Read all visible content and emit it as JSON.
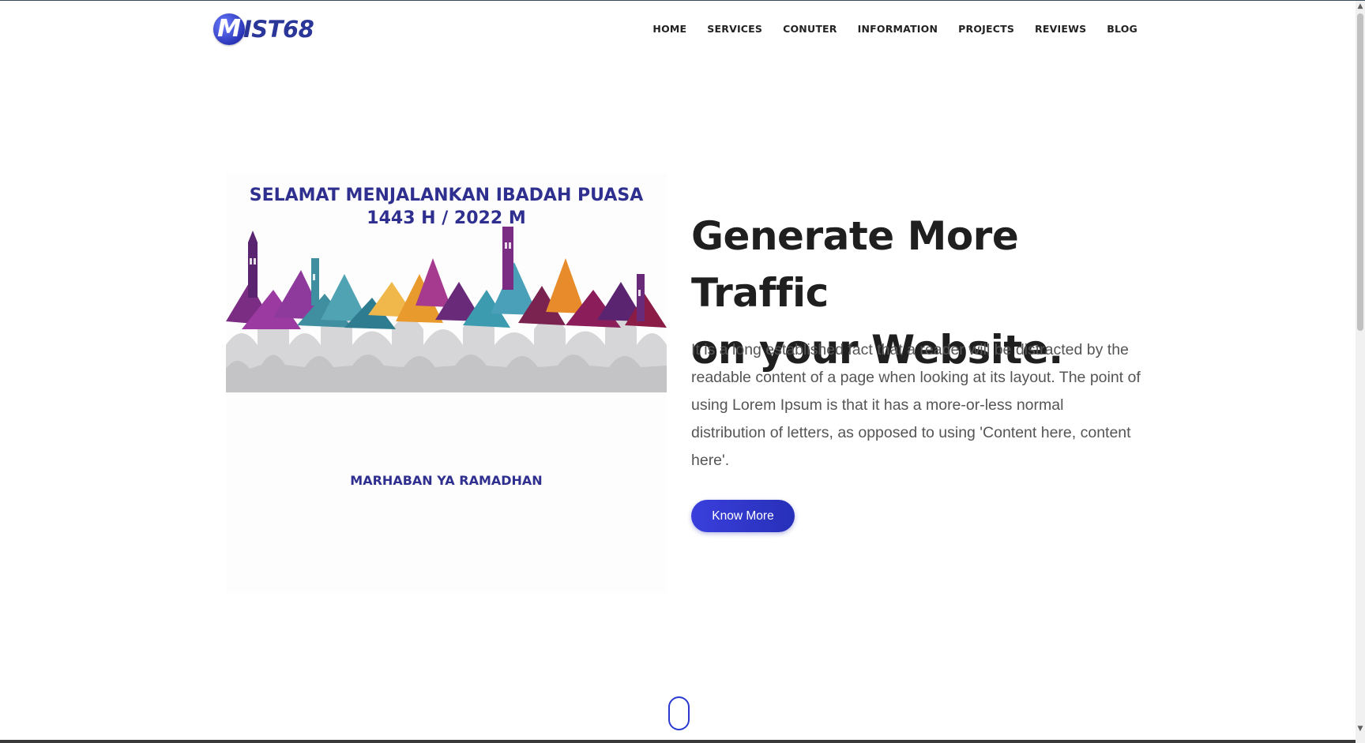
{
  "logo": {
    "badge_letter": "M",
    "text": "IST68"
  },
  "nav": {
    "items": [
      "HOME",
      "SERVICES",
      "CONUTER",
      "INFORMATION",
      "PROJECTS",
      "REVIEWS",
      "BLOG"
    ]
  },
  "banner": {
    "title_line1": "SELAMAT MENJALANKAN IBADAH PUASA",
    "title_line2": "1443 H / 2022 M",
    "footer": "MARHABAN YA RAMADHAN"
  },
  "hero": {
    "title_line1": "Generate More Traffic",
    "title_line2": "on your Website.",
    "description": "It is a long established fact that a reader will be distracted by the readable content of a page when looking at its layout. The point of using Lorem Ipsum is that it has a more-or-less normal distribution of letters, as opposed to using 'Content here, content here'.",
    "cta_label": "Know More"
  },
  "icons": {
    "scroll_down": "mouse-scroll-icon",
    "scroll_up_arrow": "▲",
    "scroll_down_arrow": "▼"
  },
  "colors": {
    "accent": "#2f37c9",
    "banner_text": "#2f2f8f",
    "heading": "#1f1f1f",
    "body": "#555555"
  }
}
